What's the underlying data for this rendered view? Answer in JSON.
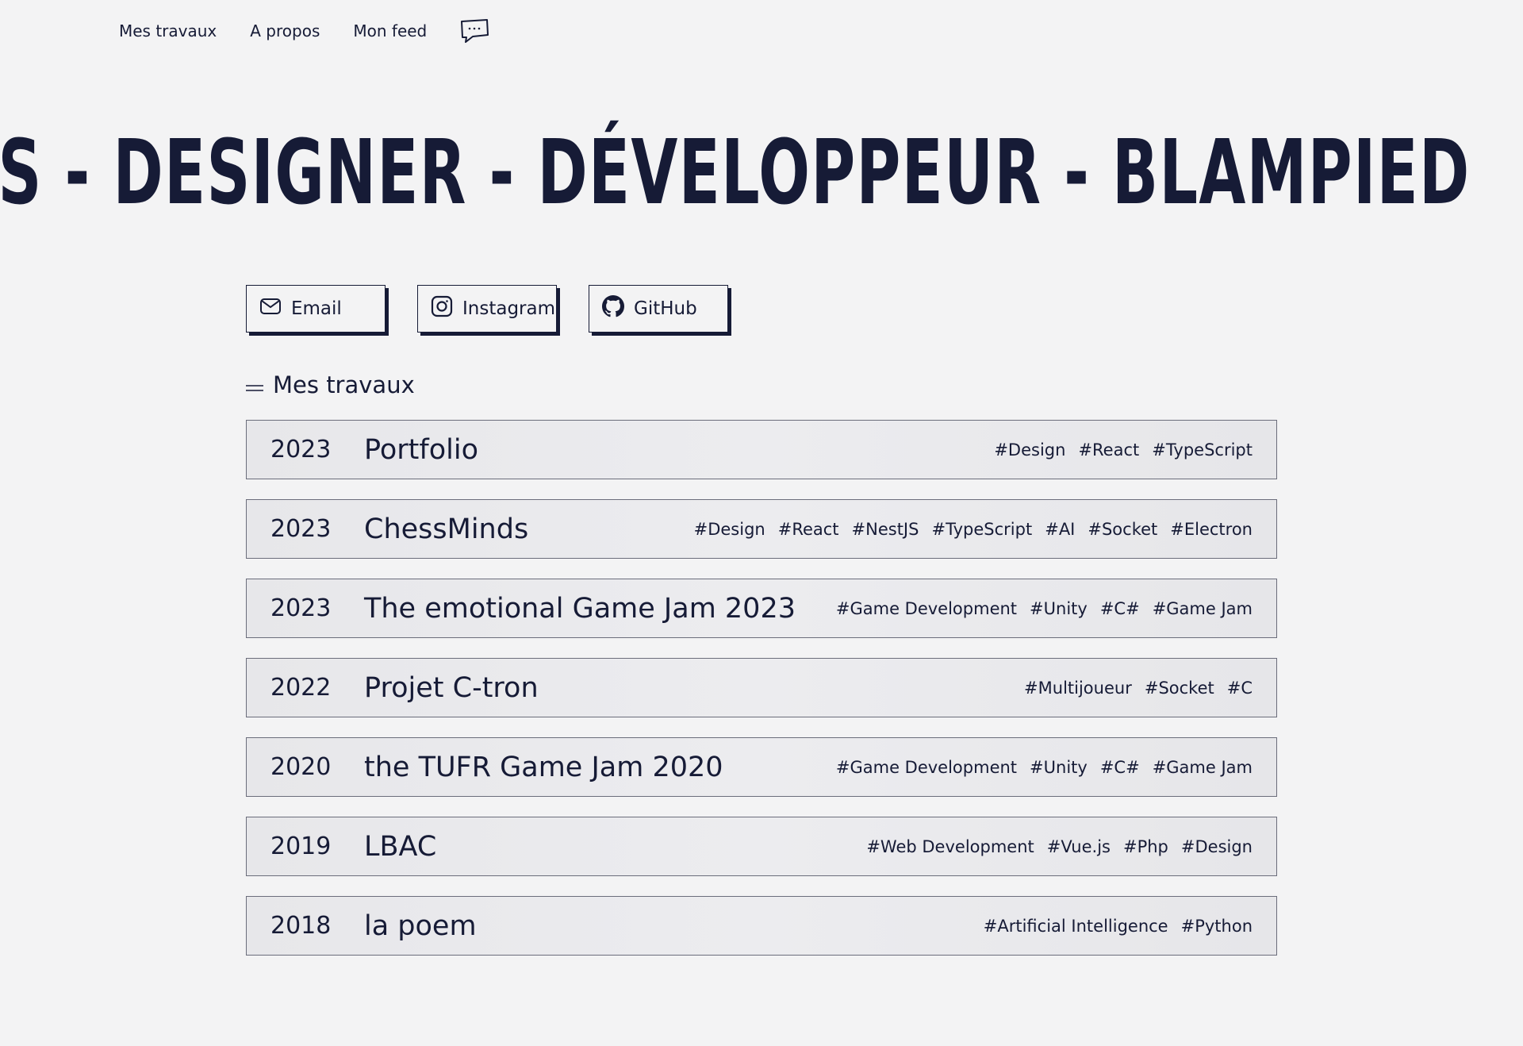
{
  "nav": {
    "items": [
      "Mes travaux",
      "A propos",
      "Mon feed"
    ],
    "chat_icon": "chat-bubble-icon"
  },
  "banner": {
    "text": "CAS - DESIGNER - DÉVELOPPEUR - BLAMPIED"
  },
  "socials": [
    {
      "label": "Email",
      "icon": "mail-icon"
    },
    {
      "label": "Instagram",
      "icon": "instagram-icon"
    },
    {
      "label": "GitHub",
      "icon": "github-icon"
    }
  ],
  "works": {
    "title": "Mes travaux",
    "items": [
      {
        "year": "2023",
        "title": "Portfolio",
        "tags": [
          "#Design",
          "#React",
          "#TypeScript"
        ]
      },
      {
        "year": "2023",
        "title": "ChessMinds",
        "tags": [
          "#Design",
          "#React",
          "#NestJS",
          "#TypeScript",
          "#AI",
          "#Socket",
          "#Electron"
        ]
      },
      {
        "year": "2023",
        "title": "The emotional Game Jam 2023",
        "tags": [
          "#Game Development",
          "#Unity",
          "#C#",
          "#Game Jam"
        ]
      },
      {
        "year": "2022",
        "title": "Projet C-tron",
        "tags": [
          "#Multijoueur",
          "#Socket",
          "#C"
        ]
      },
      {
        "year": "2020",
        "title": "the TUFR Game Jam 2020",
        "tags": [
          "#Game Development",
          "#Unity",
          "#C#",
          "#Game Jam"
        ]
      },
      {
        "year": "2019",
        "title": "LBAC",
        "tags": [
          "#Web Development",
          "#Vue.js",
          "#Php",
          "#Design"
        ]
      },
      {
        "year": "2018",
        "title": "la poem",
        "tags": [
          "#Artificial Intelligence",
          "#Python"
        ]
      }
    ]
  },
  "colors": {
    "text": "#161b36",
    "background": "#f3f3f4",
    "row_background": "#e9e9ec"
  }
}
